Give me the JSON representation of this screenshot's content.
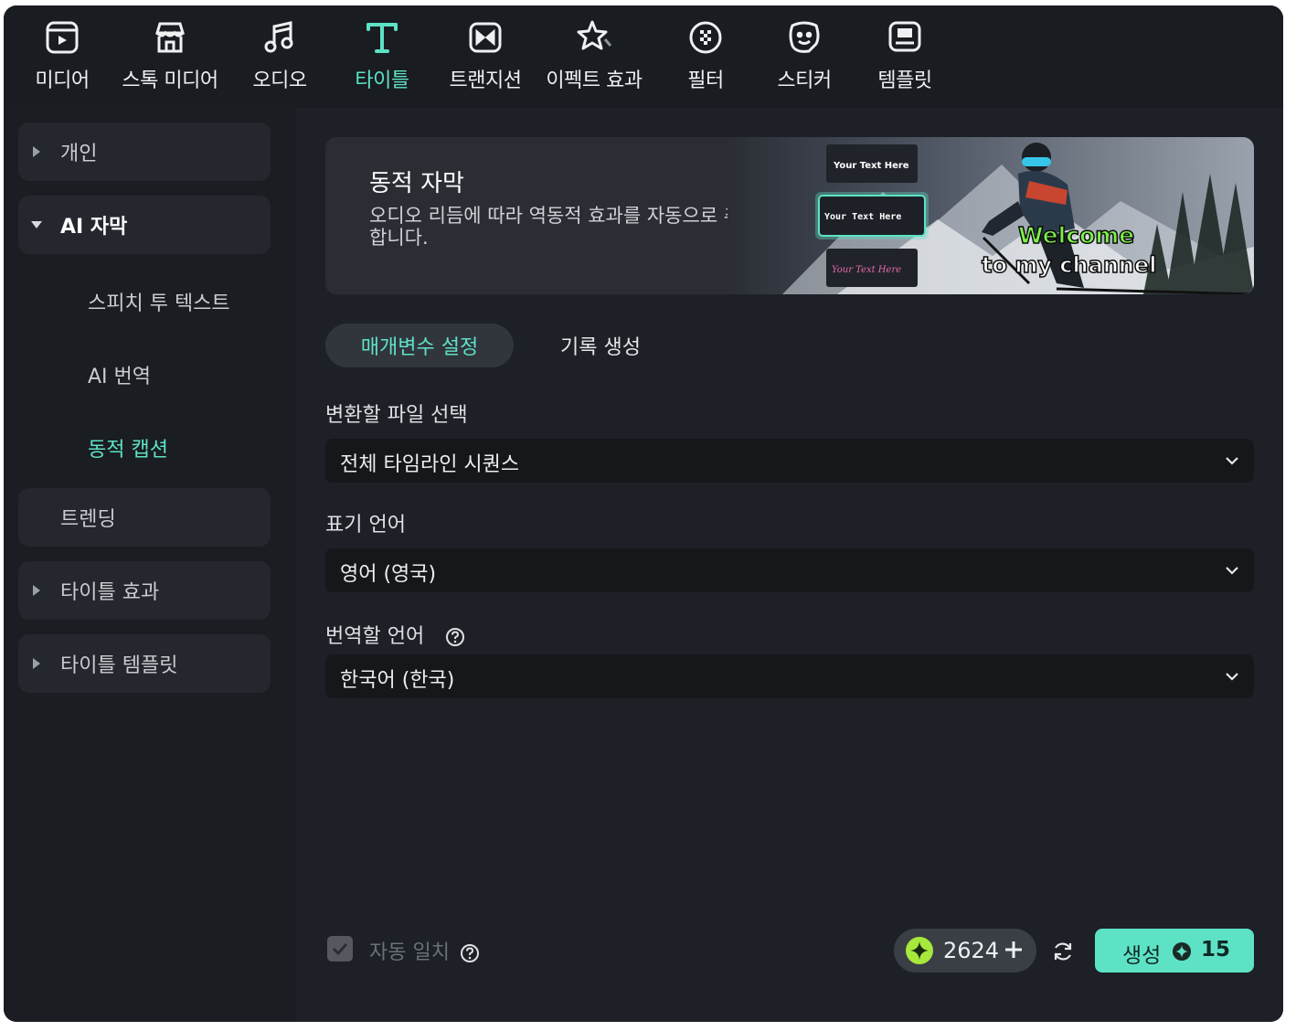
{
  "toolbar": {
    "items": [
      {
        "label": "미디어",
        "icon": "media-icon"
      },
      {
        "label": "스톡 미디어",
        "icon": "stock-media-icon"
      },
      {
        "label": "오디오",
        "icon": "music-note-icon"
      },
      {
        "label": "타이틀",
        "icon": "title-t-icon",
        "active": true
      },
      {
        "label": "트랜지션",
        "icon": "transition-icon"
      },
      {
        "label": "이펙트 효과",
        "icon": "effect-star-icon"
      },
      {
        "label": "필터",
        "icon": "filter-icon"
      },
      {
        "label": "스티커",
        "icon": "sticker-icon"
      },
      {
        "label": "템플릿",
        "icon": "template-icon"
      }
    ]
  },
  "sidebar": {
    "items": [
      {
        "label": "개인",
        "expanded": false
      },
      {
        "label": "AI 자막",
        "expanded": true
      },
      {
        "label": "스피치 투 텍스트"
      },
      {
        "label": "AI 번역"
      },
      {
        "label": "동적 캡션",
        "active": true
      },
      {
        "label": "트렌딩"
      },
      {
        "label": "타이틀 효과",
        "expanded": false
      },
      {
        "label": "타이틀 템플릿",
        "expanded": false
      }
    ]
  },
  "banner": {
    "title": "동적 자막",
    "description": "오디오 리듬에 따라 역동적 효과를 자동으로 추가합니다.",
    "art": {
      "sample1": "Your Text Here",
      "sample2": "Your Text Here",
      "sample3": "Your Text Here",
      "welcome_line1": "Welcome",
      "welcome_line2": "to my channel"
    }
  },
  "tabs": {
    "active": "매개변수 설정",
    "inactive": "기록 생성"
  },
  "form": {
    "file_label": "변환할 파일 선택",
    "file_value": "전체 타임라인 시퀀스",
    "language_label": "표기 언어",
    "language_value": "영어 (영국)",
    "translate_label": "번역할 언어",
    "translate_value": "한국어 (한국)"
  },
  "footer": {
    "auto_match_label": "자동 일치",
    "auto_match_checked": true,
    "credits": "2624",
    "generate_label": "생성",
    "generate_cost": "15"
  },
  "colors": {
    "accent": "#5ee2c5",
    "background": "#1d2026",
    "sidebar": "#1a1d22",
    "select_bg": "#15171b"
  }
}
